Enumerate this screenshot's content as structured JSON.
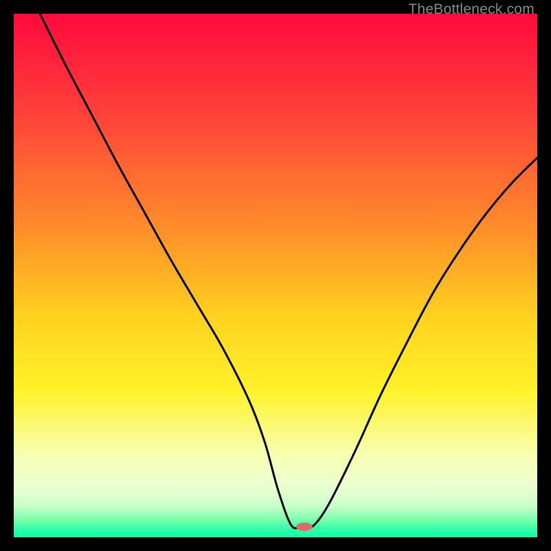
{
  "watermark": "TheBottleneck.com",
  "chart_data": {
    "type": "line",
    "title": "",
    "xlabel": "",
    "ylabel": "",
    "xlim": [
      0,
      100
    ],
    "ylim": [
      0,
      100
    ],
    "gradient_stops": [
      {
        "offset": 0,
        "color": "#ff0a3c"
      },
      {
        "offset": 0.18,
        "color": "#ff3e3a"
      },
      {
        "offset": 0.4,
        "color": "#ff8a2a"
      },
      {
        "offset": 0.58,
        "color": "#ffd21f"
      },
      {
        "offset": 0.72,
        "color": "#fff22a"
      },
      {
        "offset": 0.84,
        "color": "#f8ffb0"
      },
      {
        "offset": 0.9,
        "color": "#ecffd0"
      },
      {
        "offset": 0.94,
        "color": "#c8ffca"
      },
      {
        "offset": 0.965,
        "color": "#7effad"
      },
      {
        "offset": 0.985,
        "color": "#2effa6"
      },
      {
        "offset": 1.0,
        "color": "#0affb0"
      }
    ],
    "series": [
      {
        "name": "bottleneck-curve",
        "x": [
          5,
          10,
          15,
          20,
          25,
          30,
          35,
          40,
          45,
          48,
          50.5,
          53,
          55,
          57,
          60,
          65,
          70,
          75,
          80,
          85,
          90,
          95,
          100
        ],
        "y": [
          100,
          90,
          80.5,
          71,
          62,
          53,
          44.5,
          36,
          26,
          18,
          9,
          2.3,
          2.0,
          2.0,
          6,
          16,
          27,
          37,
          46.5,
          54.5,
          61.5,
          67.5,
          72.5
        ]
      }
    ],
    "marker": {
      "x": 55.5,
      "y": 2.0,
      "color": "#e06a6a",
      "rx": 12,
      "ry": 6
    }
  }
}
